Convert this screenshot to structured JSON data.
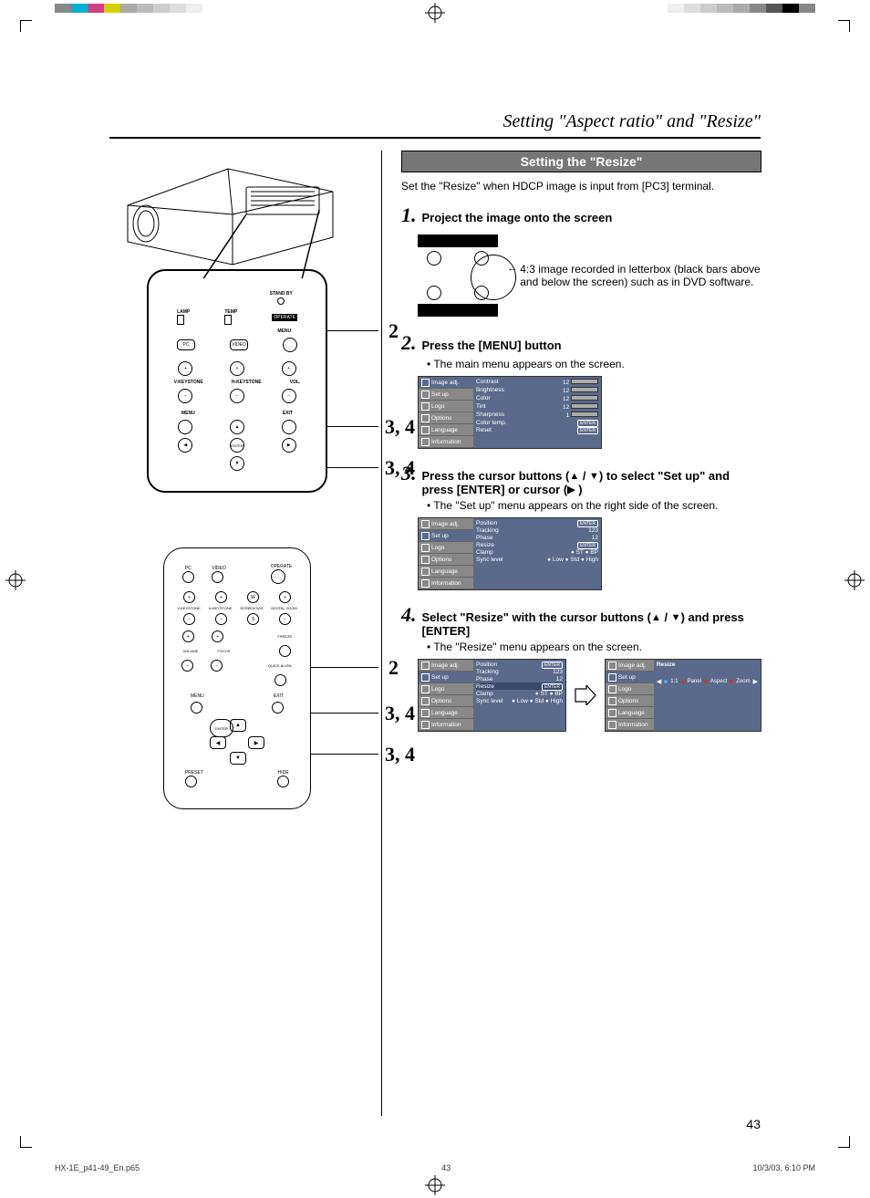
{
  "header": {
    "title": "Setting \"Aspect ratio\" and \"Resize\""
  },
  "section_bar": "Setting the \"Resize\"",
  "intro": "Set the \"Resize\" when HDCP image is input from [PC3] terminal.",
  "steps": {
    "s1": {
      "num": "1.",
      "title": "Project the image onto the screen",
      "caption": "4:3 image recorded in letterbox (black bars above and below the screen) such as in DVD software."
    },
    "s2": {
      "num": "2.",
      "title": "Press the [MENU] button",
      "bullet": "The main menu appears on the screen."
    },
    "s3": {
      "num": "3.",
      "title_a": "Press the cursor buttons (",
      "title_b": " / ",
      "title_c": ") to select \"Set up\" and press [ENTER] or cursor (",
      "title_d": " )",
      "bullet": "The \"Set up\" menu appears on the right side of the screen."
    },
    "s4": {
      "num": "4.",
      "title_a": "Select \"Resize\" with the cursor buttons  (",
      "title_b": " / ",
      "title_c": ") and press [ENTER]",
      "bullet": "The \"Resize\" menu appears on the screen."
    }
  },
  "menu_tabs": [
    "Image adj.",
    "Set up",
    "Logo",
    "Options",
    "Language",
    "Information"
  ],
  "menu1_rows": [
    {
      "l": "Contrast",
      "v": "12",
      "bar": true
    },
    {
      "l": "Brightness",
      "v": "12",
      "bar": true
    },
    {
      "l": "Color",
      "v": "12",
      "bar": true
    },
    {
      "l": "Tint",
      "v": "12",
      "bar": true
    },
    {
      "l": "Sharpness",
      "v": "1",
      "bar": true
    },
    {
      "l": "Color temp.",
      "v": "ENTER",
      "enter": true
    },
    {
      "l": "Reset",
      "v": "ENTER",
      "enter": true
    }
  ],
  "menu2_rows": [
    {
      "l": "Position",
      "v": "ENTER",
      "enter": true
    },
    {
      "l": "Tracking",
      "v": "123"
    },
    {
      "l": "Phase",
      "v": "12"
    },
    {
      "l": "Resize",
      "v": "ENTER",
      "enter": true
    },
    {
      "l": "Clamp",
      "v": "● ST    ● BP"
    },
    {
      "l": "Sync level",
      "v": "● Low ● Std    ● High"
    }
  ],
  "menu3_rows": [
    {
      "l": "Position",
      "v": "ENTER",
      "enter": true
    },
    {
      "l": "Tracking",
      "v": "123"
    },
    {
      "l": "Phase",
      "v": "12"
    },
    {
      "l": "Resize",
      "v": "ENTER",
      "enter": true,
      "sel": true
    },
    {
      "l": "Clamp",
      "v": "● ST    ● BP"
    },
    {
      "l": "Sync level",
      "v": "● Low ● Std    ● High"
    }
  ],
  "menu4": {
    "title": "Resize",
    "opts": [
      "1:1",
      "Panel",
      "Aspect",
      "Zoom"
    ]
  },
  "control_panel": {
    "standby": "STAND BY",
    "operate": "OPERATE",
    "lamp": "LAMP",
    "temp": "TEMP",
    "menu_top": "MENU",
    "pc": "PC",
    "video": "VIDEO",
    "vkey": "V-KEYSTONE",
    "hkey": "H-KEYSTONE",
    "vol": "VOL.",
    "menu": "MENU",
    "exit": "EXIT",
    "enter": "ENTER"
  },
  "cp_callouts": {
    "c2": "2",
    "c34a": "3, 4",
    "c34b": "3, 4"
  },
  "remote": {
    "pc": "PC",
    "video": "VIDEO",
    "operate": "OPERATE",
    "vkey": "V-KEYSTONE",
    "hkey": "H-KEYSTONE",
    "screen": "SCREEN\nW/S",
    "dzoom": "DIGITAL\nZOOM",
    "volume": "VOLUME",
    "focus": "FOCUS",
    "freeze": "FREEZE",
    "qalign": "QUICK ALIGN.",
    "menu": "MENU",
    "exit": "EXIT",
    "enter": "ENTER",
    "preset": "PRESET",
    "hide": "HIDE"
  },
  "rm_callouts": {
    "c2": "2",
    "c34a": "3, 4",
    "c34b": "3, 4"
  },
  "pagenum": "43",
  "footer": {
    "file": "HX-1E_p41-49_En.p65",
    "page": "43",
    "date": "10/3/03, 6:10 PM"
  }
}
